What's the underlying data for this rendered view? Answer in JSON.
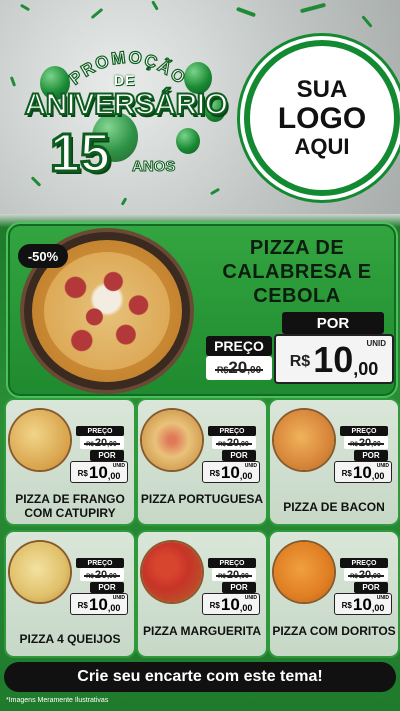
{
  "header": {
    "promo_arc": "PROMOÇÃO",
    "de": "DE",
    "aniversario": "ANIVERSÁRIO",
    "anos_number": "15",
    "anos": "ANOS",
    "logo_line1": "SUA",
    "logo_line2": "LOGO",
    "logo_line3": "AQUI"
  },
  "featured": {
    "discount": "-50%",
    "title": "PIZZA DE CALABRESA E CEBOLA",
    "preco_label": "PREÇO",
    "old_rs": "R$",
    "old_int": "20",
    "old_cents": ",00",
    "por_label": "POR",
    "unid": "UNID",
    "new_rs": "R$",
    "new_int": "10",
    "new_cents": ",00"
  },
  "cards": [
    {
      "name": "PIZZA DE FRANGO COM CATUPIRY",
      "preco": "PREÇO",
      "old_rs": "R$",
      "old": "20",
      "old_c": ",00",
      "por": "POR",
      "unid": "UNID",
      "rs": "R$",
      "int": "10",
      "cents": ",00"
    },
    {
      "name": "PIZZA PORTUGUESA",
      "preco": "PREÇO",
      "old_rs": "R$",
      "old": "20",
      "old_c": ",00",
      "por": "POR",
      "unid": "UNID",
      "rs": "R$",
      "int": "10",
      "cents": ",00"
    },
    {
      "name": "PIZZA DE BACON",
      "preco": "PREÇO",
      "old_rs": "R$",
      "old": "20",
      "old_c": ",00",
      "por": "POR",
      "unid": "UNID",
      "rs": "R$",
      "int": "10",
      "cents": ",00"
    },
    {
      "name": "PIZZA 4 QUEIJOS",
      "preco": "PREÇO",
      "old_rs": "R$",
      "old": "20",
      "old_c": ",00",
      "por": "POR",
      "unid": "UNID",
      "rs": "R$",
      "int": "10",
      "cents": ",00"
    },
    {
      "name": "PIZZA MARGUERITA",
      "preco": "PREÇO",
      "old_rs": "R$",
      "old": "20",
      "old_c": ",00",
      "por": "POR",
      "unid": "UNID",
      "rs": "R$",
      "int": "10",
      "cents": ",00"
    },
    {
      "name": "PIZZA COM DORITOS",
      "preco": "PREÇO",
      "old_rs": "R$",
      "old": "20",
      "old_c": ",00",
      "por": "POR",
      "unid": "UNID",
      "rs": "R$",
      "int": "10",
      "cents": ",00"
    }
  ],
  "footer": {
    "cta": "Crie seu encarte com este tema!",
    "disclaimer": "*Imagens Meramente Ilustrativas"
  },
  "colors": {
    "brand_green": "#1f8a2f",
    "dark": "#111111"
  }
}
